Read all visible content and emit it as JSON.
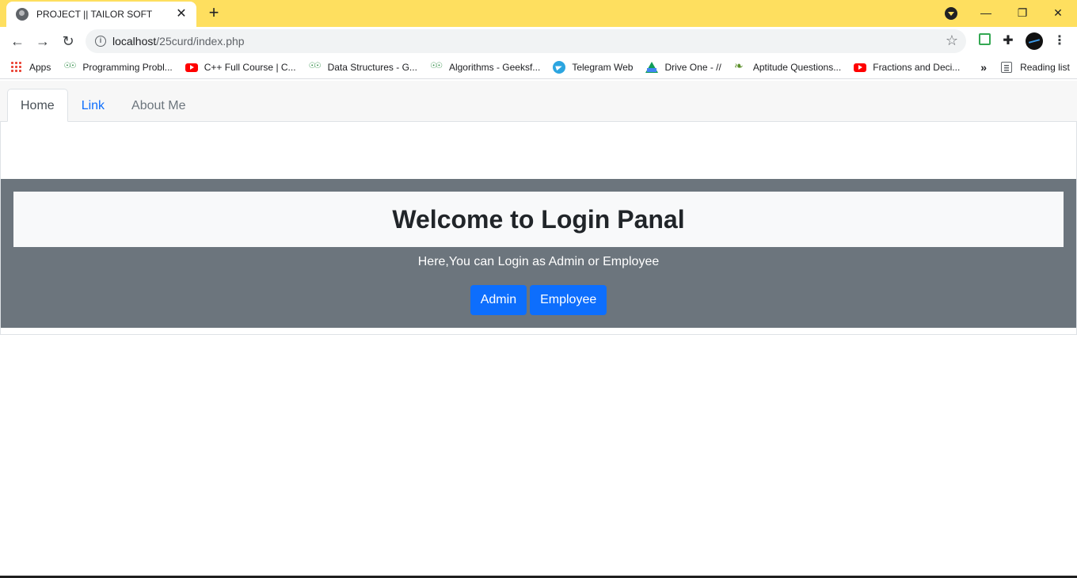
{
  "browser": {
    "tab_title": "PROJECT || TAILOR SOFT",
    "tab_close": "✕",
    "new_tab": "+",
    "window_controls": {
      "minimize": "—",
      "restore": "❐",
      "close": "✕"
    },
    "nav": {
      "back": "←",
      "forward": "→",
      "reload": "↻"
    },
    "url_host": "localhost",
    "url_path": "/25curd/index.php",
    "star": "☆",
    "menu": "⋮",
    "puzzle": "✚",
    "bookmarks": [
      {
        "label": "Apps",
        "icon": "apps-grid-icon"
      },
      {
        "label": "Programming Probl...",
        "icon": "geeksforgeeks-icon"
      },
      {
        "label": "C++ Full Course | C...",
        "icon": "youtube-icon"
      },
      {
        "label": "Data Structures - G...",
        "icon": "geeksforgeeks-icon"
      },
      {
        "label": "Algorithms - Geeksf...",
        "icon": "geeksforgeeks-icon"
      },
      {
        "label": "Telegram Web",
        "icon": "telegram-icon"
      },
      {
        "label": "Drive One - //",
        "icon": "google-drive-icon"
      },
      {
        "label": "Aptitude Questions...",
        "icon": "leaf-icon"
      },
      {
        "label": "Fractions and Deci...",
        "icon": "youtube-icon"
      }
    ],
    "bookmarks_more": "»",
    "reading_list": "Reading list"
  },
  "page": {
    "tabs": [
      {
        "label": "Home",
        "active": true
      },
      {
        "label": "Link",
        "active": false
      },
      {
        "label": "About Me",
        "active": false
      }
    ],
    "panel": {
      "title": "Welcome to Login Panal",
      "subtitle": "Here,You can Login as Admin or Employee",
      "admin_button": "Admin",
      "employee_button": "Employee"
    }
  },
  "colors": {
    "titlebar": "#fedf5f",
    "panel_bg": "#6c757d",
    "button_primary": "#0d6efd",
    "link": "#0d6efd"
  }
}
